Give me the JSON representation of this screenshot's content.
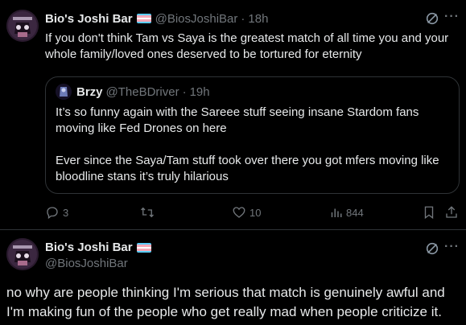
{
  "tweet": {
    "author_name": "Bio's Joshi Bar",
    "author_handle": "@BiosJoshiBar",
    "separator": "·",
    "time": "18h",
    "text": "If you don't think Tam vs Saya is the greatest match of all time you and your whole family/loved ones deserved to be tortured for eternity",
    "more": "···",
    "quote": {
      "author_name": "Brzy",
      "author_handle": "@TheBDriver",
      "separator": "·",
      "time": "19h",
      "paragraph1": "It’s so funny again with the Sareee stuff seeing insane Stardom fans moving like Fed Drones on here",
      "paragraph2": "Ever since the Saya/Tam stuff took over there you got mfers moving like bloodline stans it’s truly hilarious"
    },
    "actions": {
      "replies": "3",
      "likes": "10",
      "views": "844"
    }
  },
  "reply": {
    "author_name": "Bio's Joshi Bar",
    "author_handle": "@BiosJoshiBar",
    "more": "···",
    "text": "no why are people thinking I'm serious that match is genuinely awful and I'm making fun of the people who get really mad when people criticize it."
  },
  "colors": {
    "background": "#000000",
    "text": "#e7e9ea",
    "muted": "#71767b",
    "border": "#2f3336",
    "flag": [
      "#5bcefa",
      "#f5a9b8",
      "#ffffff",
      "#f5a9b8",
      "#5bcefa"
    ]
  },
  "icons": [
    "reply-icon",
    "retweet-icon",
    "like-icon",
    "views-icon",
    "bookmark-icon",
    "share-icon",
    "grok-icon",
    "more-icon"
  ]
}
